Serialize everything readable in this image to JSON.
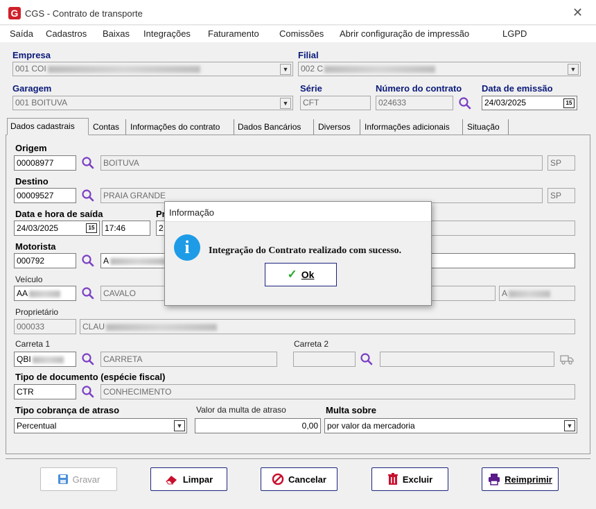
{
  "window": {
    "title": "CGS - Contrato de transporte"
  },
  "menu": [
    "Saída",
    "Cadastros",
    "Baixas",
    "Integrações",
    "Faturamento",
    "Comissões",
    "Abrir configuração de impressão",
    "LGPD"
  ],
  "header": {
    "empresa_label": "Empresa",
    "empresa_value": "001 COI",
    "filial_label": "Filial",
    "filial_value": "002 C",
    "garagem_label": "Garagem",
    "garagem_value": "001 BOITUVA",
    "serie_label": "Série",
    "serie_value": "CFT",
    "numero_label": "Número do contrato",
    "numero_value": "024633",
    "data_emissao_label": "Data de emissão",
    "data_emissao_value": "24/03/2025"
  },
  "tabs": [
    "Dados cadastrais",
    "Contas",
    "Informações do contrato",
    "Dados Bancários",
    "Diversos",
    "Informações adicionais",
    "Situação"
  ],
  "form": {
    "origem_label": "Origem",
    "origem_code": "00008977",
    "origem_city": "BOITUVA",
    "origem_uf": "SP",
    "destino_label": "Destino",
    "destino_code": "00009527",
    "destino_city": "PRAIA GRANDE",
    "destino_uf": "SP",
    "saida_label": "Data e hora de saída",
    "saida_date": "24/03/2025",
    "saida_time": "17:46",
    "previsao_label": "Pr",
    "previsao_value": "2",
    "motorista_label": "Motorista",
    "motorista_code": "000792",
    "motorista_name": "A",
    "veiculo_label": "Veículo",
    "veiculo_code": "AA",
    "veiculo_type": "CAVALO",
    "veiculo_plate": "A",
    "proprietario_label": "Proprietário",
    "proprietario_code": "000033",
    "proprietario_name": "CLAU",
    "carreta1_label": "Carreta 1",
    "carreta1_code": "QBI",
    "carreta1_type": "CARRETA",
    "carreta2_label": "Carreta 2",
    "tipo_doc_label": "Tipo de documento (espécie fiscal)",
    "tipo_doc_code": "CTR",
    "tipo_doc_name": "CONHECIMENTO",
    "cobranca_label": "Tipo cobrança de atraso",
    "cobranca_value": "Percentual",
    "multa_valor_label": "Valor da multa de atraso",
    "multa_valor": "0,00",
    "multa_sobre_label": "Multa sobre",
    "multa_sobre_value": "por valor da mercadoria"
  },
  "dialog": {
    "title": "Informação",
    "message": "Integração do Contrato realizado com sucesso.",
    "ok_label": "Ok"
  },
  "buttons": {
    "gravar": "Gravar",
    "limpar": "Limpar",
    "cancelar": "Cancelar",
    "excluir": "Excluir",
    "reimprimir": "Reimprimir"
  },
  "colors": {
    "accent": "#1a237e",
    "info": "#1e9be6",
    "danger": "#c8102e",
    "print": "#5a1a8a",
    "magnifier": "#7b3fc4"
  }
}
